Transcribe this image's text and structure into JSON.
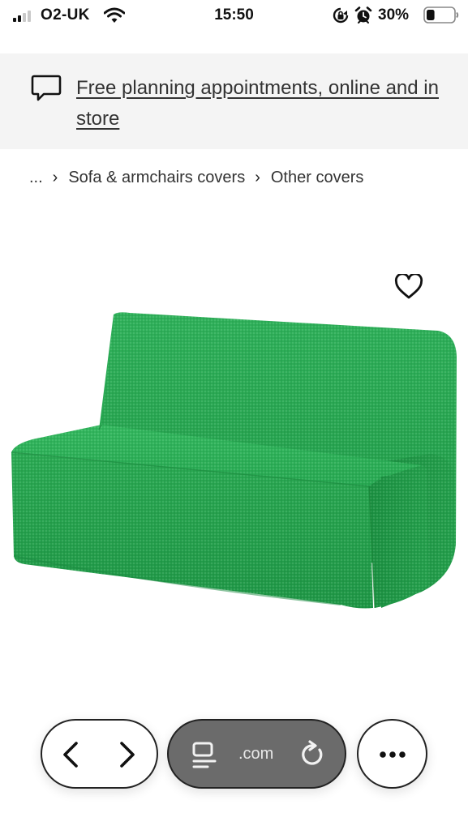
{
  "status_bar": {
    "carrier": "O2-UK",
    "time": "15:50",
    "battery_percent": "30%",
    "battery_level": 0.3,
    "icons": [
      "signal-icon",
      "wifi-icon",
      "rotation-lock-icon",
      "alarm-icon",
      "battery-icon"
    ]
  },
  "banner": {
    "icon": "chat-bubble-icon",
    "link_text": "Free planning appointments, online and in store"
  },
  "breadcrumb": {
    "items": [
      "...",
      "Sofa & armchairs covers",
      "Other covers"
    ],
    "separator": "›"
  },
  "product": {
    "image": "green-sofa-bed-cover",
    "favorite_icon": "heart-icon",
    "color": "#26a94e"
  },
  "toolbar": {
    "back_icon": "chevron-left-icon",
    "forward_icon": "chevron-right-icon",
    "reader_icon": "reader-mode-icon",
    "url": ".com",
    "reload_icon": "reload-icon",
    "more_icon": "more-icon"
  }
}
